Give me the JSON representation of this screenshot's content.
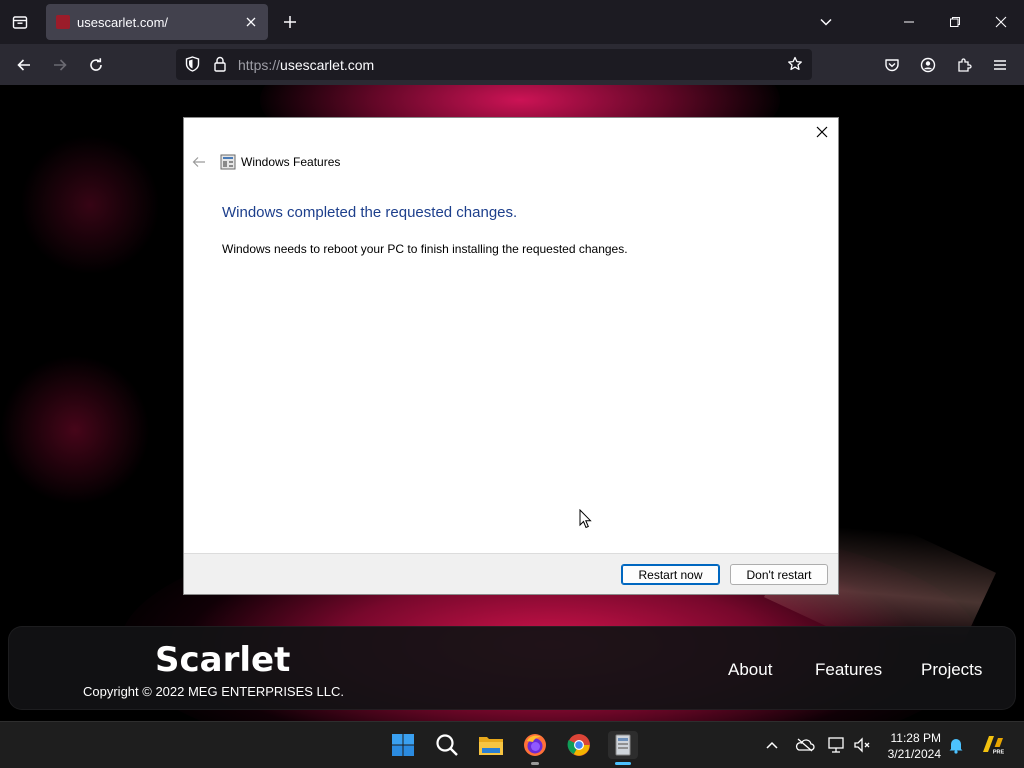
{
  "browser": {
    "tab": {
      "title": "usescarlet.com/"
    },
    "url": {
      "scheme": "https://",
      "host": "usescarlet.com"
    }
  },
  "site": {
    "brand": "Scarlet",
    "copyright": "Copyright © 2022 MEG ENTERPRISES LLC.",
    "nav": [
      "About",
      "Features",
      "Projects"
    ]
  },
  "dialog": {
    "app_title": "Windows Features",
    "heading": "Windows completed the requested changes.",
    "message": "Windows needs to reboot your PC to finish installing the requested changes.",
    "buttons": {
      "primary": "Restart now",
      "secondary": "Don't restart"
    }
  },
  "taskbar": {
    "time": "11:28 PM",
    "date": "3/21/2024",
    "apps": [
      "start-icon",
      "search-icon",
      "file-explorer-icon",
      "firefox-icon",
      "chrome-icon",
      "windows-features-icon"
    ]
  },
  "colors": {
    "accent": "#0067c0",
    "dialog_heading": "#1d3f8c",
    "brand_glow": "#d7145a"
  }
}
